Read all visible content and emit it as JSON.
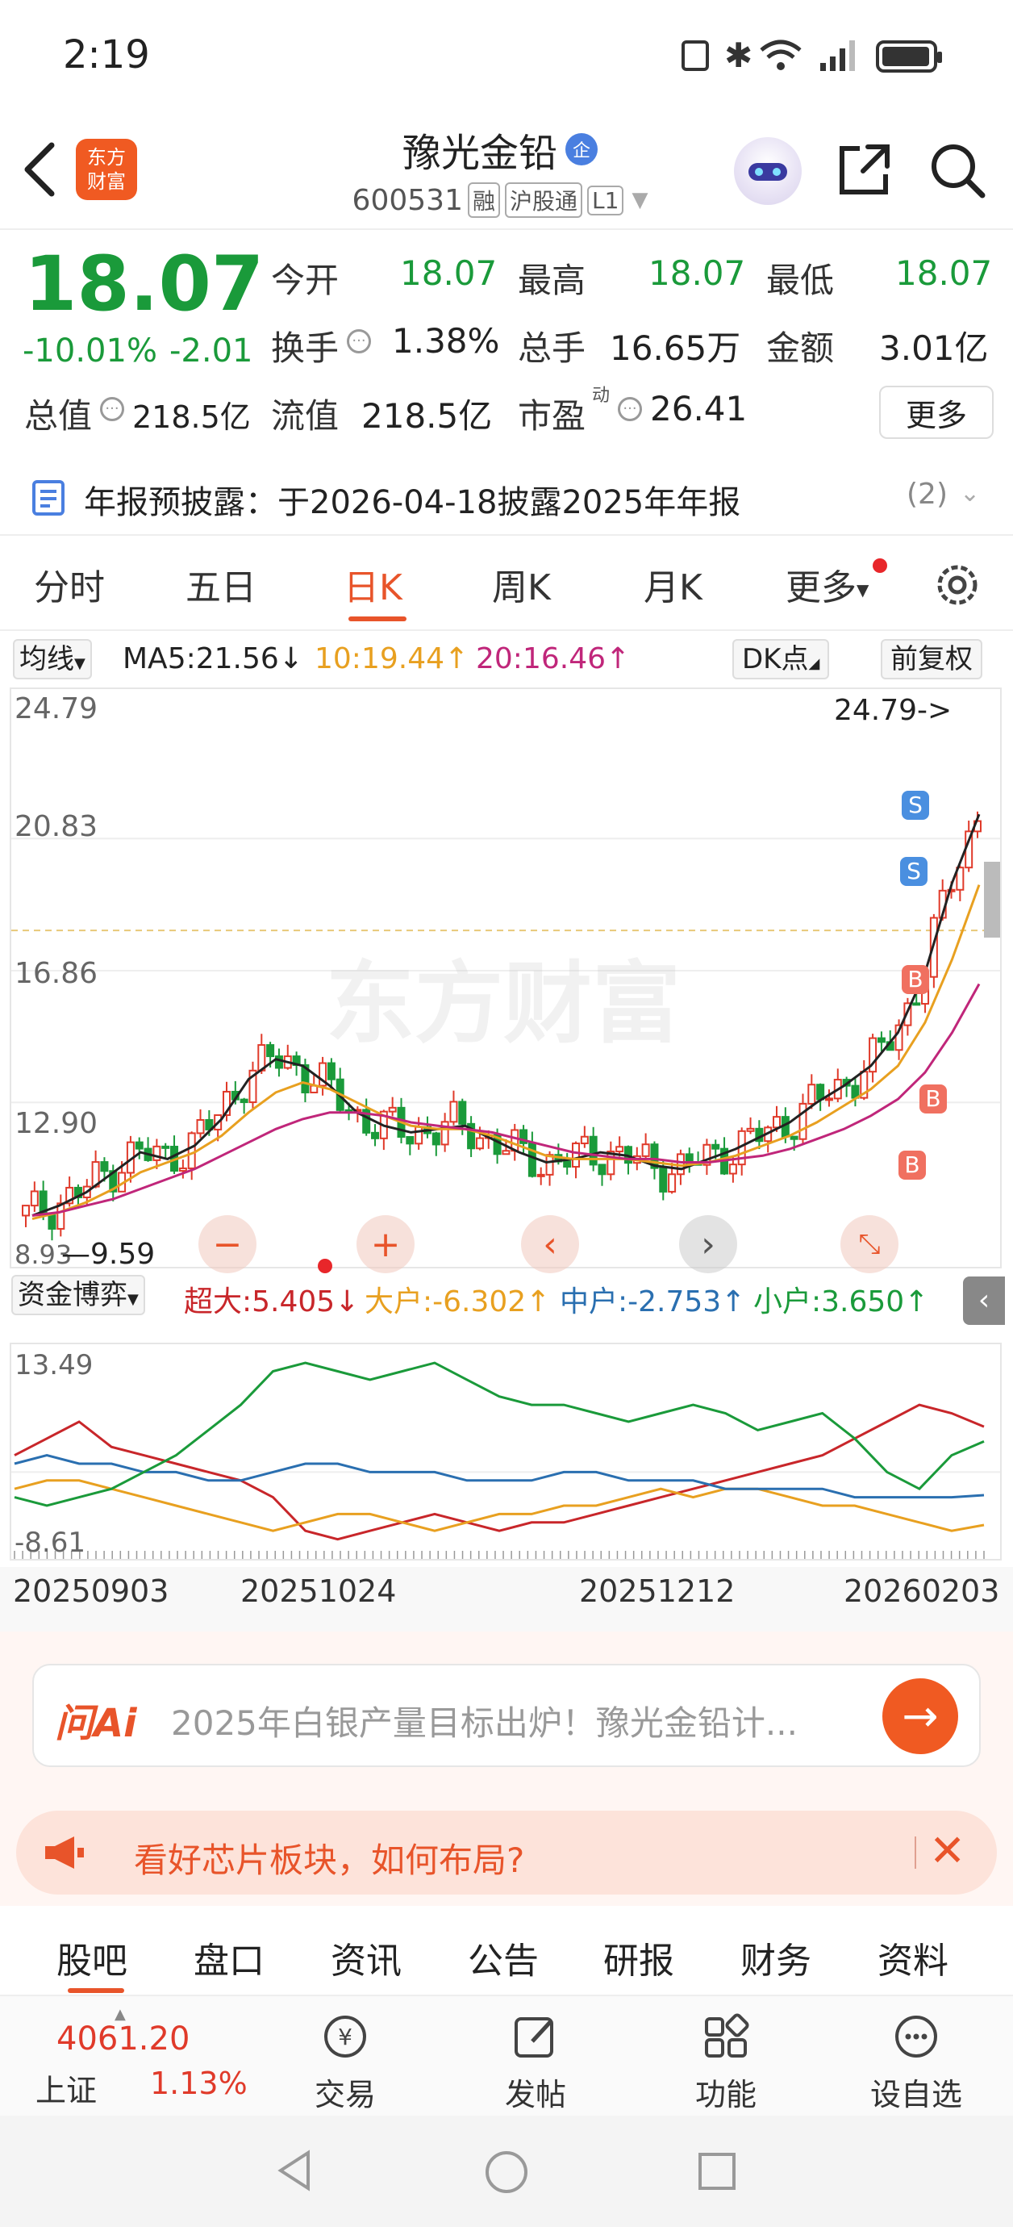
{
  "status_bar": {
    "time": "2:19"
  },
  "header": {
    "logo_text_top": "东方",
    "logo_text_bottom": "财富",
    "title": "豫光金铅",
    "badge": "企",
    "code": "600531",
    "tags": [
      "融",
      "沪股通",
      "L1"
    ]
  },
  "quote": {
    "price": "18.07",
    "change_pct": "-10.01%",
    "change_abs": "-2.01",
    "open_label": "今开",
    "open": "18.07",
    "high_label": "最高",
    "high": "18.07",
    "low_label": "最低",
    "low": "18.07",
    "turnover_label": "换手",
    "turnover": "1.38%",
    "volume_label": "总手",
    "volume": "16.65万",
    "amount_label": "金额",
    "amount": "3.01亿",
    "mcap_label": "总值",
    "mcap": "218.5亿",
    "float_label": "流值",
    "float": "218.5亿",
    "pe_label": "市盈",
    "pe_sup": "动",
    "pe": "26.41",
    "more_label": "更多"
  },
  "notice": {
    "text": "年报预披露：于2026-04-18披露2025年年报",
    "count": "(2)"
  },
  "chart_tabs": [
    "分时",
    "五日",
    "日K",
    "周K",
    "月K",
    "更多"
  ],
  "chart_tabs_active": 2,
  "indicators": {
    "ma_select": "均线",
    "ma5": "MA5:21.56↓",
    "ma10": "10:19.44↑",
    "ma20": "20:16.46↑",
    "dk_label": "DK点",
    "fq_label": "前复权"
  },
  "colors": {
    "ma5": "#222222",
    "ma10": "#e8a020",
    "ma20": "#c0267a",
    "up": "#e03a2a",
    "down": "#1a9a3a",
    "accent": "#e8542a"
  },
  "chart_data": [
    {
      "type": "candlestick",
      "y_ticks": [
        "24.79",
        "20.83",
        "16.86",
        "12.90",
        "8.93"
      ],
      "ylim": [
        8.93,
        24.79
      ],
      "annotations": {
        "max": "24.79->",
        "min": "9.59"
      },
      "series": [
        {
          "name": "MA5",
          "values": [
            9.5,
            9.8,
            10.2,
            10.8,
            11.4,
            11.2,
            11.6,
            12.4,
            13.6,
            14.2,
            14.0,
            13.4,
            12.6,
            12.2,
            12.0,
            12.1,
            12.2,
            11.8,
            11.4,
            11.1,
            11.2,
            11.4,
            11.3,
            11.0,
            10.9,
            11.2,
            11.5,
            11.9,
            12.3,
            12.9,
            13.4,
            14.0,
            15.0,
            16.8,
            19.5,
            21.56
          ]
        },
        {
          "name": "MA10",
          "values": [
            9.4,
            9.6,
            9.9,
            10.3,
            10.8,
            11.1,
            11.4,
            11.9,
            12.6,
            13.2,
            13.5,
            13.3,
            12.9,
            12.5,
            12.2,
            12.1,
            12.1,
            11.9,
            11.6,
            11.3,
            11.2,
            11.2,
            11.2,
            11.1,
            11.0,
            11.1,
            11.3,
            11.6,
            11.9,
            12.3,
            12.8,
            13.3,
            14.0,
            15.3,
            17.2,
            19.44
          ]
        },
        {
          "name": "MA20",
          "values": [
            9.5,
            9.6,
            9.8,
            10.0,
            10.3,
            10.6,
            10.9,
            11.3,
            11.7,
            12.1,
            12.4,
            12.6,
            12.6,
            12.5,
            12.3,
            12.2,
            12.1,
            12.0,
            11.8,
            11.6,
            11.4,
            11.3,
            11.2,
            11.2,
            11.1,
            11.1,
            11.2,
            11.3,
            11.5,
            11.8,
            12.1,
            12.5,
            13.0,
            13.8,
            15.0,
            16.46
          ]
        }
      ],
      "signals": [
        {
          "label": "S"
        },
        {
          "label": "S"
        },
        {
          "label": "B"
        },
        {
          "label": "B"
        },
        {
          "label": "B"
        }
      ]
    },
    {
      "type": "line",
      "title": "资金博弈",
      "y_ticks": [
        "13.49",
        "-8.61"
      ],
      "ylim": [
        -8.61,
        13.49
      ],
      "x_labels": [
        "20250903",
        "20251024",
        "20251212",
        "20260203"
      ],
      "series": [
        {
          "name": "超大",
          "label": "超大:5.405↓",
          "color": "#c8262a",
          "values": [
            2,
            4,
            6,
            3,
            2,
            1,
            0,
            -1,
            -3,
            -7,
            -8,
            -7,
            -6,
            -5,
            -6,
            -7,
            -6,
            -6,
            -5,
            -4,
            -3,
            -2,
            -1,
            0,
            1,
            2,
            4,
            6,
            8,
            7,
            5.405
          ]
        },
        {
          "name": "大户",
          "label": "大户:-6.302↑",
          "color": "#e8a020",
          "values": [
            -2,
            -1,
            -1,
            -2,
            -3,
            -4,
            -5,
            -6,
            -7,
            -6,
            -5,
            -5,
            -6,
            -7,
            -6,
            -5,
            -5,
            -4,
            -4,
            -3,
            -2,
            -3,
            -2,
            -2,
            -3,
            -4,
            -4,
            -5,
            -6,
            -7,
            -6.302
          ]
        },
        {
          "name": "中户",
          "label": "中户:-2.753↑",
          "color": "#2a6fb0",
          "values": [
            1,
            2,
            1,
            1,
            0,
            0,
            -1,
            -1,
            0,
            1,
            1,
            0,
            0,
            0,
            -1,
            -1,
            -1,
            0,
            0,
            -1,
            -1,
            -1,
            -2,
            -2,
            -2,
            -2,
            -3,
            -3,
            -3,
            -3,
            -2.753
          ]
        },
        {
          "name": "小户",
          "label": "小户:3.650↑",
          "color": "#1a9a3a",
          "values": [
            -3,
            -4,
            -3,
            -2,
            0,
            2,
            5,
            8,
            12,
            13,
            12,
            11,
            12,
            13,
            11,
            9,
            8,
            8,
            7,
            6,
            7,
            8,
            7,
            5,
            6,
            7,
            4,
            0,
            -2,
            2,
            3.65
          ]
        }
      ]
    }
  ],
  "ai_box": {
    "logo": "问Ai",
    "text": "2025年白银产量目标出炉！豫光金铅计..."
  },
  "promo": {
    "text": "看好芯片板块，如何布局?"
  },
  "sub_tabs": [
    "股吧",
    "盘口",
    "资讯",
    "公告",
    "研报",
    "财务",
    "资料"
  ],
  "sub_tabs_active": 0,
  "bottom_nav": {
    "index_value": "4061.20",
    "index_name": "上证",
    "index_change": "1.13%",
    "items": [
      "交易",
      "发帖",
      "功能",
      "设自选"
    ]
  }
}
